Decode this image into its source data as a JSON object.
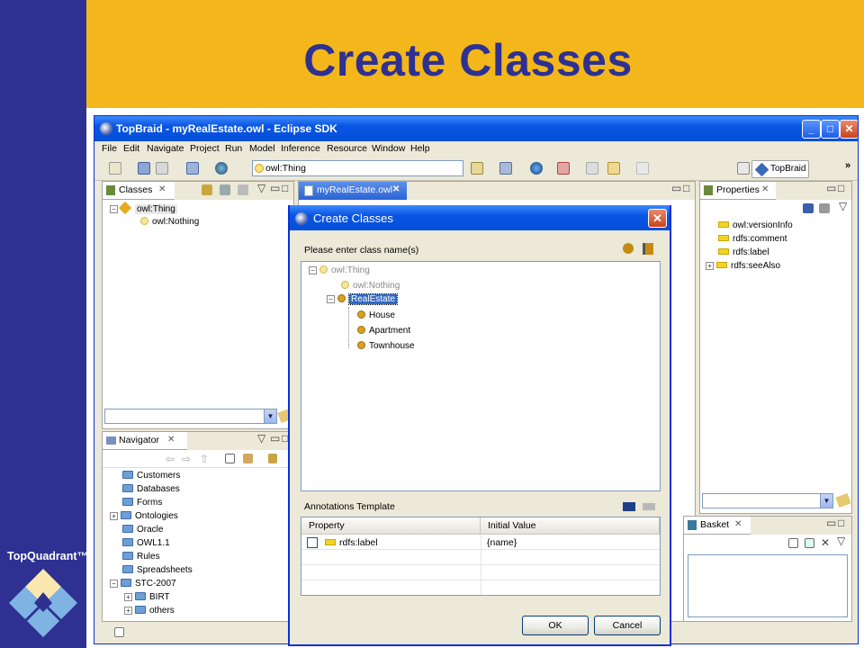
{
  "slide": {
    "title": "Create Classes",
    "logo_text": "TopQuadrant™"
  },
  "window": {
    "title": "TopBraid - myRealEstate.owl - Eclipse SDK",
    "menu": [
      "File",
      "Edit",
      "Navigate",
      "Project",
      "Run",
      "Model",
      "Inference",
      "Resource",
      "Window",
      "Help"
    ],
    "toolbar_combo_value": "owl:Thing",
    "perspective_label": "TopBraid",
    "chevron": "»"
  },
  "classes_view": {
    "tab_label": "Classes",
    "tree": [
      {
        "label": "owl:Thing",
        "toggle": "⊟"
      },
      {
        "label": "owl:Nothing"
      }
    ]
  },
  "navigator_view": {
    "tab_label": "Navigator",
    "items": [
      "Customers",
      "Databases",
      "Forms",
      "Ontologies",
      "Oracle",
      "OWL1.1",
      "Rules",
      "Spreadsheets",
      "STC-2007",
      "BIRT",
      "others"
    ]
  },
  "editor": {
    "tab_label": "myRealEstate.owl"
  },
  "properties_view": {
    "tab_label": "Properties",
    "items": [
      "owl:versionInfo",
      "rdfs:comment",
      "rdfs:label",
      "rdfs:seeAlso"
    ]
  },
  "basket_view": {
    "tab_label": "Basket"
  },
  "dialog": {
    "title": "Create Classes",
    "prompt": "Please enter class name(s)",
    "tree": {
      "root": "owl:Thing",
      "nothing": "owl:Nothing",
      "selected": "RealEstate",
      "children": [
        "House",
        "Apartment",
        "Townhouse"
      ]
    },
    "annotations_label": "Annotations Template",
    "table": {
      "headers": [
        "Property",
        "Initial Value"
      ],
      "rows": [
        {
          "property": "rdfs:label",
          "value": "{name}"
        }
      ]
    },
    "ok_label": "OK",
    "cancel_label": "Cancel"
  }
}
